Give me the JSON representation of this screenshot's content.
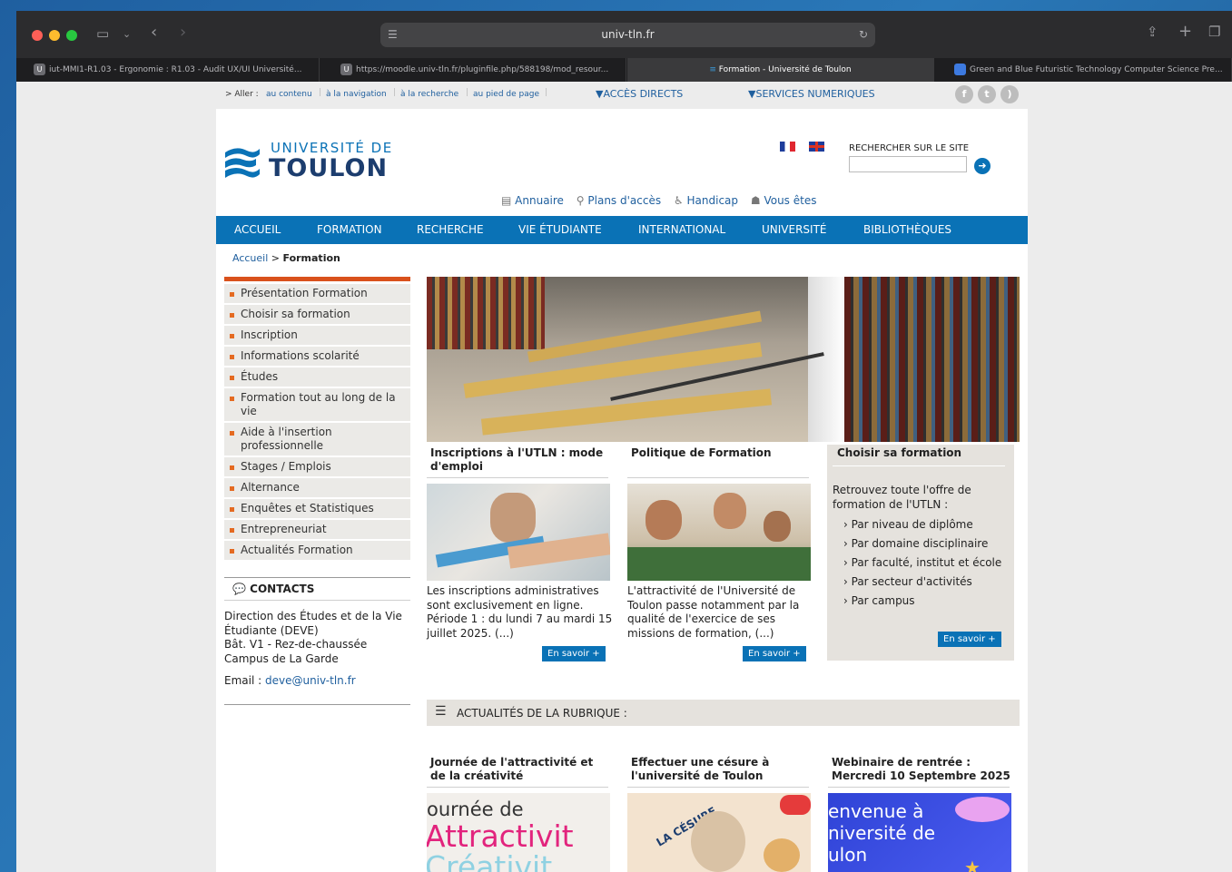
{
  "browser": {
    "url": "univ-tln.fr",
    "tabs": [
      {
        "favicon": "U",
        "label": "iut-MMI1-R1.03 - Ergonomie : R1.03 - Audit UX/UI Université..."
      },
      {
        "favicon": "U",
        "label": "https://moodle.univ-tln.fr/pluginfile.php/588198/mod_resour..."
      },
      {
        "favicon": "",
        "label": "Formation - Université de Toulon"
      },
      {
        "favicon": "",
        "label": "Green and Blue Futuristic Technology Computer Science Pre..."
      }
    ]
  },
  "skip": {
    "prefix": "> Aller :",
    "links": [
      "au contenu",
      "à la navigation",
      "à la recherche",
      "au pied de page"
    ],
    "acces_directs": "ACCÈS DIRECTS",
    "services": "SERVICES NUMERIQUES"
  },
  "header": {
    "logo_line1": "UNIVERSITÉ DE",
    "logo_line2": "TOULON",
    "search_label": "RECHERCHER SUR LE SITE",
    "search_placeholder": "",
    "util_links": [
      "Annuaire",
      "Plans d'accès",
      "Handicap",
      "Vous êtes"
    ]
  },
  "nav": [
    "ACCUEIL",
    "FORMATION",
    "RECHERCHE",
    "VIE ÉTUDIANTE",
    "INTERNATIONAL",
    "UNIVERSITÉ",
    "BIBLIOTHÈQUES"
  ],
  "breadcrumb": {
    "home": "Accueil",
    "separator": ">",
    "current": "Formation"
  },
  "sidebar": {
    "items": [
      "Présentation Formation",
      "Choisir sa formation",
      "Inscription",
      "Informations scolarité",
      "Études",
      "Formation tout au long de la vie",
      "Aide à l'insertion professionnelle",
      "Stages / Emplois",
      "Alternance",
      "Enquêtes et Statistiques",
      "Entrepreneuriat",
      "Actualités Formation"
    ],
    "contacts_title": "CONTACTS",
    "contact_lines": [
      "Direction des Études et de la Vie Étudiante (DEVE)",
      "Bât. V1 - Rez-de-chaussée",
      "Campus de La Garde"
    ],
    "email_label": "Email :",
    "email": "deve@univ-tln.fr"
  },
  "columns": [
    {
      "title": "Inscriptions à l'UTLN : mode d'emploi",
      "text": "Les inscriptions administratives sont exclusivement en ligne. Période 1 : du lundi 7 au mardi 15 juillet 2025. (...)",
      "button": "En savoir +"
    },
    {
      "title": "Politique de Formation",
      "text": "L'attractivité de l'Université de Toulon passe notamment par la qualité de l'exercice de ses missions de formation, (...)",
      "button": "En savoir +"
    }
  ],
  "choisir": {
    "title": "Choisir sa formation",
    "intro": "Retrouvez toute l'offre de formation de l'UTLN :",
    "links": [
      "Par niveau de diplôme",
      "Par domaine disciplinaire",
      "Par faculté, institut et école",
      "Par secteur d'activités",
      "Par campus"
    ],
    "button": "En savoir +"
  },
  "actualites": {
    "heading": "ACTUALITÉS DE LA RUBRIQUE :",
    "items": [
      {
        "title": "Journée de l'attractivité et de la créativité",
        "image_text": [
          "ournée de",
          "Attractivit",
          "Créativit"
        ]
      },
      {
        "title": "Effectuer une césure à l'université de Toulon",
        "image_text": [
          "LA CÉSURE"
        ]
      },
      {
        "title": "Webinaire de rentrée : Mercredi 10 Septembre 2025",
        "image_text": [
          "envenue à",
          "niversité de",
          "ulon"
        ]
      }
    ]
  }
}
